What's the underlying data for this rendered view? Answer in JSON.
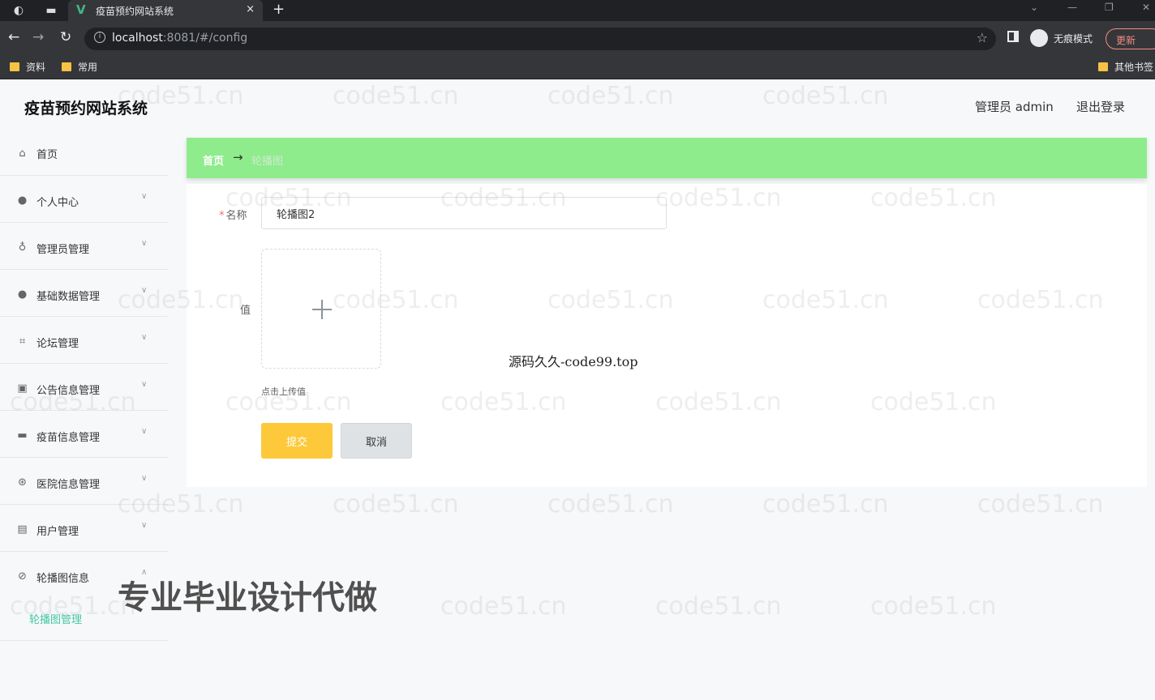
{
  "browser": {
    "tab_title": "疫苗预约网站系统",
    "tab_close": "×",
    "new_tab": "+",
    "url_host": "localhost",
    "url_rest": ":8081/#/config",
    "incognito_label": "无痕模式",
    "update_label": "更新",
    "bookmarks": [
      "资料",
      "常用"
    ],
    "other_bookmarks": "其他书签"
  },
  "app": {
    "title": "疫苗预约网站系统",
    "user_label": "管理员 admin",
    "logout_label": "退出登录"
  },
  "sidebar": {
    "items": [
      {
        "label": "首页",
        "icon": "home-icon"
      },
      {
        "label": "个人中心",
        "icon": "user-icon"
      },
      {
        "label": "管理员管理",
        "icon": "microphone-icon"
      },
      {
        "label": "基础数据管理",
        "icon": "user-icon"
      },
      {
        "label": "论坛管理",
        "icon": "crop-icon"
      },
      {
        "label": "公告信息管理",
        "icon": "chart-icon"
      },
      {
        "label": "疫苗信息管理",
        "icon": "monitor-icon"
      },
      {
        "label": "医院信息管理",
        "icon": "aperture-icon"
      },
      {
        "label": "用户管理",
        "icon": "clipboard-icon"
      },
      {
        "label": "轮播图信息",
        "icon": "compass-icon"
      }
    ],
    "submenu": {
      "label": "轮播图管理"
    }
  },
  "breadcrumb": {
    "home": "首页",
    "arrow": "→",
    "current": "轮播图"
  },
  "form": {
    "name_label": "名称",
    "name_value": "轮播图2",
    "value_label": "值",
    "upload_tip": "点击上传值",
    "submit_label": "提交",
    "cancel_label": "取消"
  },
  "overlay": {
    "center_text": "源码久久-code99.top",
    "big_text": "专业毕业设计代做",
    "watermark": "code51.cn"
  }
}
